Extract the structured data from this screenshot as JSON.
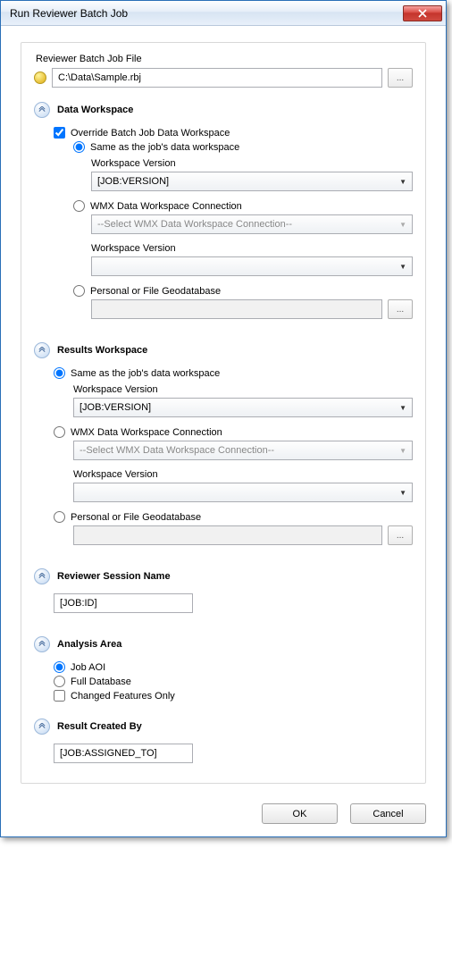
{
  "window": {
    "title": "Run Reviewer Batch Job"
  },
  "batchFile": {
    "groupLabel": "Reviewer Batch Job File",
    "path": "C:\\Data\\Sample.rbj",
    "browse": "..."
  },
  "dataWorkspace": {
    "title": "Data Workspace",
    "overrideLabel": "Override Batch Job Data Workspace",
    "overrideChecked": true,
    "options": {
      "sameAsJob": {
        "label": "Same as the job's data workspace",
        "selected": true,
        "versionLabel": "Workspace Version",
        "versionValue": "[JOB:VERSION]"
      },
      "wmx": {
        "label": "WMX Data Workspace Connection",
        "selected": false,
        "connPlaceholder": "--Select WMX Data Workspace Connection--",
        "versionLabel": "Workspace Version",
        "versionValue": ""
      },
      "personal": {
        "label": "Personal or File Geodatabase",
        "selected": false,
        "path": "",
        "browse": "..."
      }
    }
  },
  "resultsWorkspace": {
    "title": "Results Workspace",
    "options": {
      "sameAsJob": {
        "label": "Same as the job's data workspace",
        "selected": true,
        "versionLabel": "Workspace Version",
        "versionValue": "[JOB:VERSION]"
      },
      "wmx": {
        "label": "WMX Data Workspace Connection",
        "selected": false,
        "connPlaceholder": "--Select WMX Data Workspace Connection--",
        "versionLabel": "Workspace Version",
        "versionValue": ""
      },
      "personal": {
        "label": "Personal or File Geodatabase",
        "selected": false,
        "path": "",
        "browse": "..."
      }
    }
  },
  "sessionName": {
    "title": "Reviewer Session Name",
    "value": "[JOB:ID]"
  },
  "analysisArea": {
    "title": "Analysis Area",
    "options": {
      "jobAoi": {
        "label": "Job AOI",
        "selected": true
      },
      "fullDb": {
        "label": "Full Database",
        "selected": false
      },
      "changedOnly": {
        "label": "Changed Features Only",
        "checked": false
      }
    }
  },
  "resultCreatedBy": {
    "title": "Result Created By",
    "value": "[JOB:ASSIGNED_TO]"
  },
  "footer": {
    "ok": "OK",
    "cancel": "Cancel"
  }
}
